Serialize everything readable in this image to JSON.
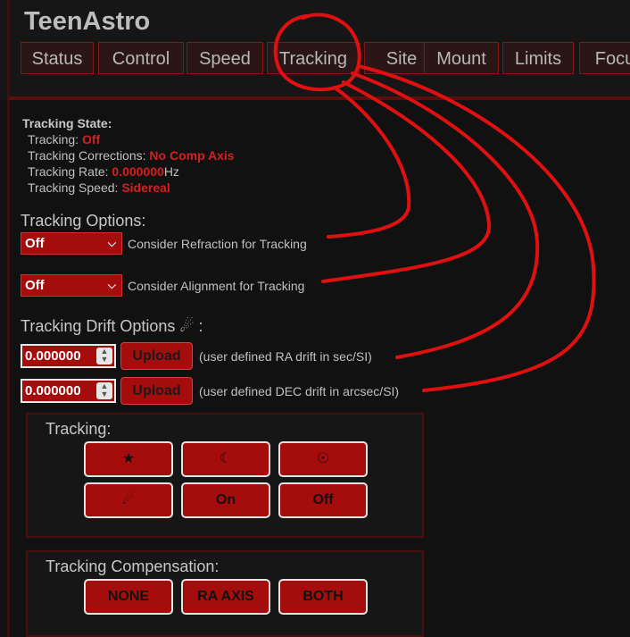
{
  "app": {
    "title": "TeenAstro"
  },
  "tabs": [
    {
      "label": "Status"
    },
    {
      "label": "Control"
    },
    {
      "label": "Speed"
    },
    {
      "label": "Tracking"
    },
    {
      "label": "Site"
    },
    {
      "label": "Mount"
    },
    {
      "label": "Limits"
    },
    {
      "label": "Focu"
    }
  ],
  "tracking_state": {
    "heading": "Tracking State:",
    "tracking_label": "Tracking: ",
    "tracking_value": "Off",
    "corrections_label": "Tracking Corrections: ",
    "corrections_value": "No Comp Axis",
    "rate_label": "Tracking Rate: ",
    "rate_value": "0.000000",
    "rate_unit": "Hz",
    "speed_label": "Tracking Speed: ",
    "speed_value": "Sidereal"
  },
  "tracking_options": {
    "title": "Tracking Options:",
    "refraction_value": "Off",
    "refraction_label": "Consider Refraction for Tracking",
    "alignment_value": "Off",
    "alignment_label": "Consider Alignment for Tracking",
    "chevron_icon": "chevron-down-icon"
  },
  "drift_options": {
    "title": "Tracking Drift Options ☄ :",
    "ra_value": "0.000000",
    "ra_button": "Upload",
    "ra_label": "(user defined RA drift in sec/SI)",
    "dec_value": "0.000000",
    "dec_button": "Upload",
    "dec_label": "(user defined DEC drift in arcsec/SI)"
  },
  "tracking_panel": {
    "title": "Tracking:",
    "buttons": [
      {
        "label": "★",
        "icon": "star-icon"
      },
      {
        "label": "☾",
        "icon": "moon-icon"
      },
      {
        "label": "☉",
        "icon": "sun-icon"
      },
      {
        "label": "☄",
        "icon": "comet-icon"
      },
      {
        "label": "On"
      },
      {
        "label": "Off"
      }
    ]
  },
  "compensation_panel": {
    "title": "Tracking Compensation:",
    "buttons": [
      {
        "label": "NONE"
      },
      {
        "label": "RA AXIS"
      },
      {
        "label": "BOTH"
      }
    ]
  },
  "colors": {
    "accent": "#a50c0c",
    "status_red": "#d42020",
    "background": "#111111",
    "annotation": "#e01010"
  }
}
